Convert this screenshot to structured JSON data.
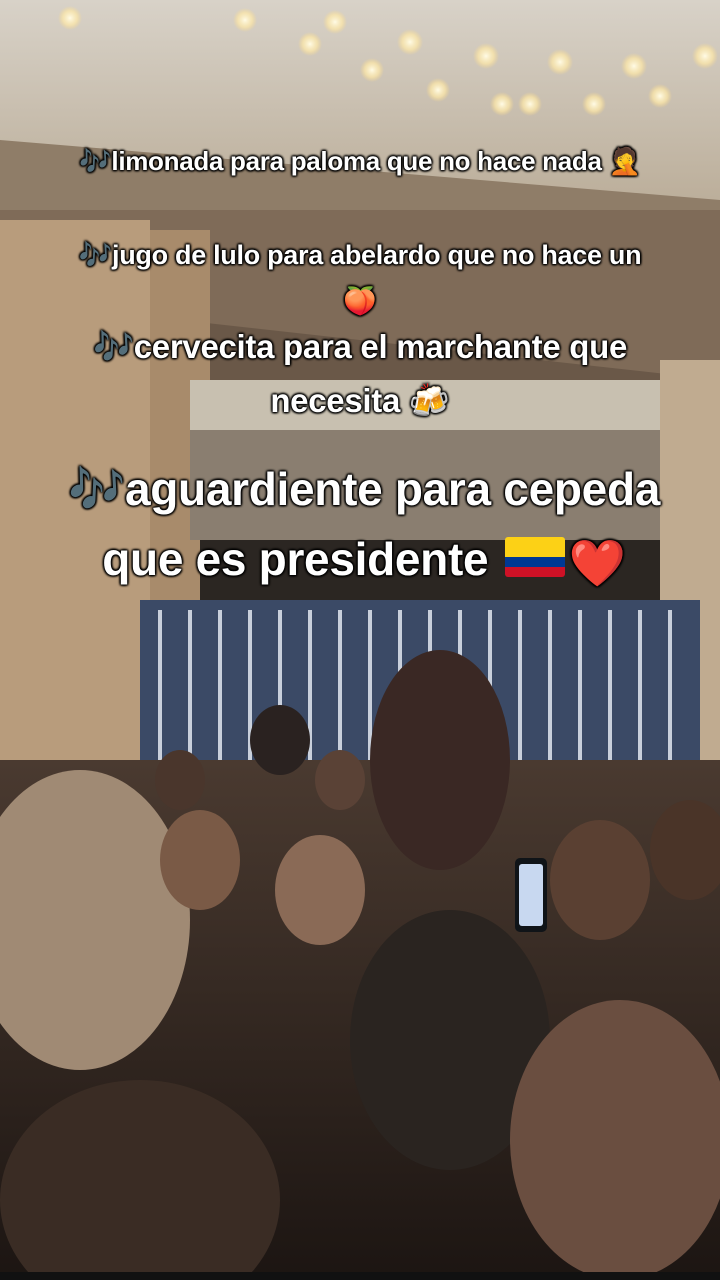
{
  "captions": {
    "line1": {
      "note": "🎶",
      "text": "limonada para paloma que no hace nada",
      "emoji": "🤦"
    },
    "line2": {
      "note": "🎶",
      "text": "jugo de lulo para abelardo que no hace un",
      "emoji": "🍑"
    },
    "line3": {
      "note": "🎶",
      "text_a": "cervecita para el marchante que",
      "text_b": "necesita",
      "emoji": "🍻"
    },
    "line4": {
      "note": "🎶",
      "text_a": "aguardiente para cepeda",
      "text_b": "que es presidente",
      "heart": "❤️"
    }
  },
  "flag_colors": [
    "#FCD116",
    "#003893",
    "#CE1126"
  ],
  "icons": {
    "music": "music-notes-icon",
    "flag": "colombia-flag-icon",
    "heart": "red-heart-icon"
  }
}
